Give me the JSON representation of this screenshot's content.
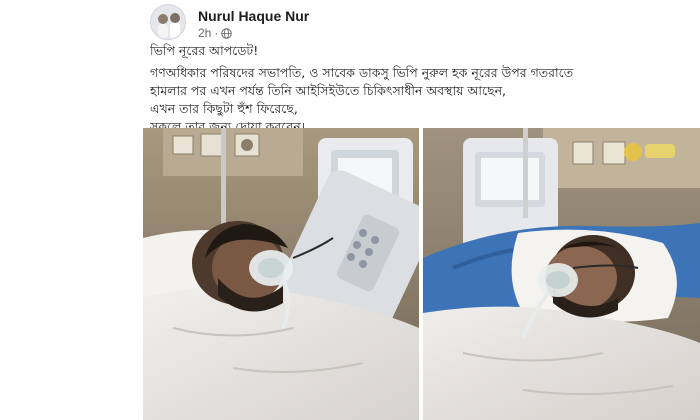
{
  "post": {
    "author": "Nurul Haque Nur",
    "time": "2h",
    "separator": "·",
    "headline": "ভিপি নূরের আপডেট!",
    "lines": [
      "গণঅধিকার পরিষদের সভাপতি, ও সাবেক ডাকসু ভিপি নুরুল হক নূরের উপর গতরাতে",
      "হামলার পর এখন পর্যন্ত তিনি আইসিইউতে চিকিৎসাধীন অবস্থায় আছেন,",
      "এখন তার কিছুটা হুঁশ ফিরেছে,",
      "সকলে তার জন্য দোয়া করবেন।"
    ],
    "photos": [
      {
        "name": "patient-photo-left"
      },
      {
        "name": "patient-photo-right"
      }
    ]
  },
  "icons": {
    "avatar": "profile-avatar",
    "audience": "globe-icon"
  },
  "colors": {
    "text": "#1c1e21",
    "secondary": "#65676b",
    "sheet": "#eceae7",
    "blanket": "#3d74b8"
  }
}
